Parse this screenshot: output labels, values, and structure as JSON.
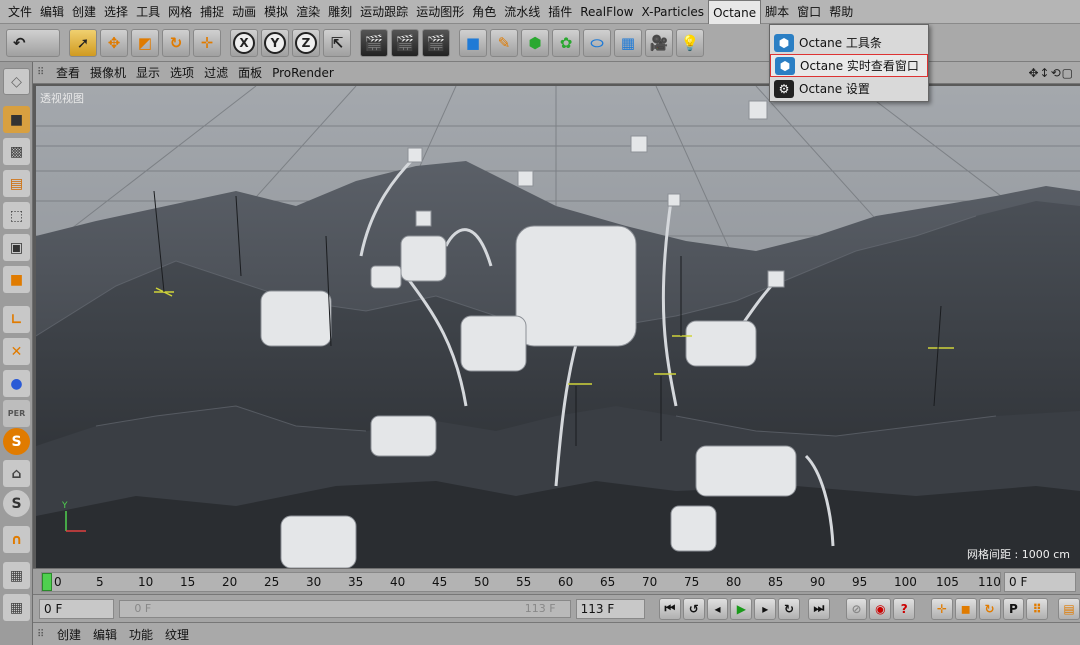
{
  "menubar": {
    "items": [
      "文件",
      "编辑",
      "创建",
      "选择",
      "工具",
      "网格",
      "捕捉",
      "动画",
      "模拟",
      "渲染",
      "雕刻",
      "运动跟踪",
      "运动图形",
      "角色",
      "流水线",
      "插件",
      "RealFlow",
      "X-Particles",
      "Octane",
      "脚本",
      "窗口",
      "帮助"
    ],
    "active": "Octane"
  },
  "octane_menu": {
    "items": [
      {
        "label": "Octane 工具条",
        "icon": "octane-toolbar-icon"
      },
      {
        "label": "Octane 实时查看窗口",
        "icon": "octane-liveviewer-icon",
        "highlighted": true
      },
      {
        "label": "Octane 设置",
        "icon": "octane-settings-icon"
      }
    ]
  },
  "toolbar": {
    "axis_x": "X",
    "axis_y": "Y",
    "axis_z": "Z"
  },
  "viewport": {
    "menu": [
      "查看",
      "摄像机",
      "显示",
      "选项",
      "过滤",
      "面板",
      "ProRender"
    ],
    "view_name": "透视视图",
    "grid_spacing": "网格间距 : 1000 cm"
  },
  "timeline": {
    "ticks": [
      "0",
      "5",
      "10",
      "15",
      "20",
      "25",
      "30",
      "35",
      "40",
      "45",
      "50",
      "55",
      "60",
      "65",
      "70",
      "75",
      "80",
      "85",
      "90",
      "95",
      "100",
      "105",
      "110"
    ],
    "current_frame": "0 F"
  },
  "transport": {
    "start": "0 F",
    "range_start": "0 F",
    "range_end": "113 F",
    "end": "113 F"
  },
  "bottom": {
    "menu": [
      "创建",
      "编辑",
      "功能",
      "纹理"
    ]
  },
  "colors": {
    "accent": "#d33333",
    "play": "#1a9a1a",
    "playhead": "#4fd04f"
  }
}
